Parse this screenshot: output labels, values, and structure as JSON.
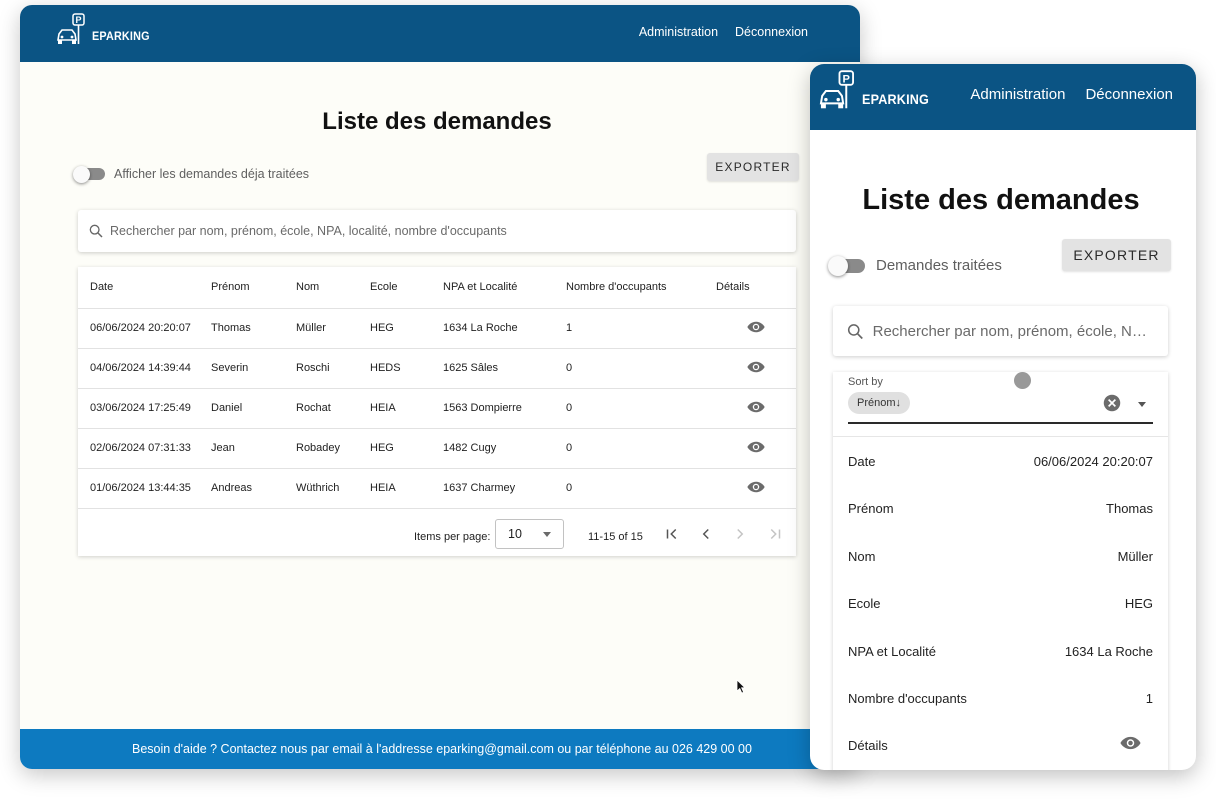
{
  "app": {
    "logo_text": "EPARKING"
  },
  "nav": {
    "admin": "Administration",
    "logout": "Déconnexion"
  },
  "desktop": {
    "title": "Liste des demandes",
    "toggle_label": "Afficher les demandes déja traitées",
    "export": "EXPORTER",
    "search_placeholder": "Rechercher par nom, prénom, école, NPA, localité, nombre d'occupants",
    "columns": [
      "Date",
      "Prénom",
      "Nom",
      "Ecole",
      "NPA et Localité",
      "Nombre d'occupants",
      "Détails"
    ],
    "rows": [
      [
        "06/06/2024 20:20:07",
        "Thomas",
        "Müller",
        "HEG",
        "1634 La Roche",
        "1"
      ],
      [
        "04/06/2024 14:39:44",
        "Severin",
        "Roschi",
        "HEDS",
        "1625 Sâles",
        "0"
      ],
      [
        "03/06/2024 17:25:49",
        "Daniel",
        "Rochat",
        "HEIA",
        "1563 Dompierre",
        "0"
      ],
      [
        "02/06/2024 07:31:33",
        "Jean",
        "Robadey",
        "HEG",
        "1482 Cugy",
        "0"
      ],
      [
        "01/06/2024 13:44:35",
        "Andreas",
        "Wüthrich",
        "HEIA",
        "1637 Charmey",
        "0"
      ]
    ],
    "pager": {
      "items_per_page_label": "Items per page:",
      "items_per_page": "10",
      "range": "11-15 of 15"
    },
    "footer": "Besoin d'aide ? Contactez nous par email à l'addresse eparking@gmail.com ou par téléphone au 026 429 00 00"
  },
  "mobile": {
    "title": "Liste des demandes",
    "toggle_label": "Demandes traitées",
    "export": "EXPORTER",
    "search_placeholder": "Rechercher par nom, prénom, école, N…",
    "sort_label": "Sort by",
    "sort_chip": "Prénom↓",
    "fields": [
      {
        "label": "Date",
        "value": "06/06/2024 20:20:07"
      },
      {
        "label": "Prénom",
        "value": "Thomas"
      },
      {
        "label": "Nom",
        "value": "Müller"
      },
      {
        "label": "Ecole",
        "value": "HEG"
      },
      {
        "label": "NPA et Localité",
        "value": "1634 La Roche"
      },
      {
        "label": "Nombre d'occupants",
        "value": "1"
      },
      {
        "label": "Détails",
        "value": ""
      }
    ]
  },
  "colors": {
    "header": "#0b5484",
    "footer": "#0d7ac0",
    "icon": "#6b6b6b"
  },
  "icons": [
    "parking-car-logo-icon",
    "search-icon",
    "eye-icon",
    "first-page-icon",
    "prev-page-icon",
    "next-page-icon",
    "last-page-icon",
    "clear-icon",
    "dropdown-caret-icon",
    "mouse-pointer-icon"
  ]
}
